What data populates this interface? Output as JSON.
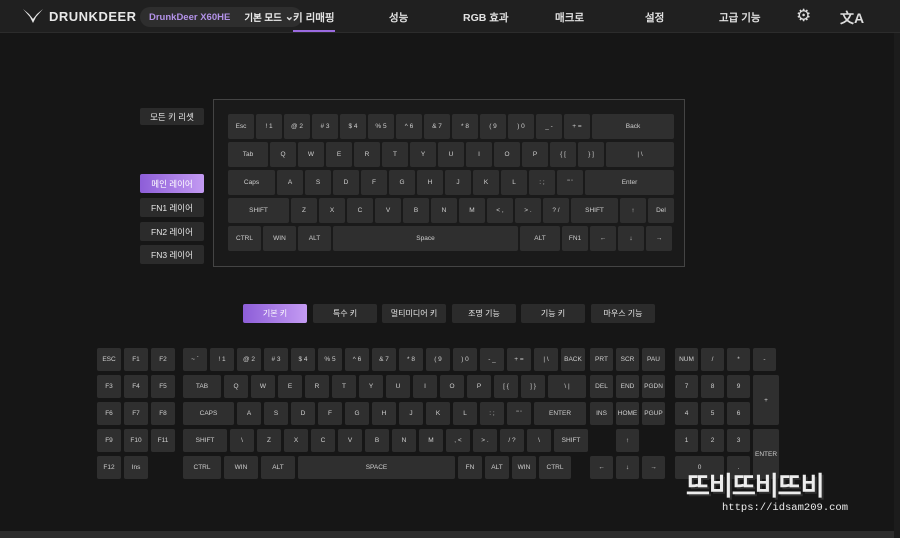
{
  "header": {
    "brand": "DRUNKDEER",
    "device": "DrunkDeer X60HE",
    "mode": "기본 모드",
    "nav": [
      "키 리매핑",
      "성능",
      "RGB 효과",
      "매크로",
      "설정",
      "고급 기능"
    ],
    "settings_icon": "gear-icon",
    "language_icon": "translate-icon"
  },
  "left_panel": {
    "reset_label": "모든 키 리셋",
    "layers": [
      "메인 레이어",
      "FN1 레이어",
      "FN2 레이어",
      "FN3 레이어"
    ],
    "active_layer": "메인 레이어"
  },
  "preview_keyboard": {
    "rows": [
      [
        "Esc",
        "! 1",
        "@ 2",
        "# 3",
        "$ 4",
        "% 5",
        "^ 6",
        "& 7",
        "* 8",
        "( 9",
        ") 0",
        "_ -",
        "+ =",
        "Back"
      ],
      [
        "Tab",
        "Q",
        "W",
        "E",
        "R",
        "T",
        "Y",
        "U",
        "I",
        "O",
        "P",
        "{ [",
        "} ]",
        "| \\"
      ],
      [
        "Caps",
        "A",
        "S",
        "D",
        "F",
        "G",
        "H",
        "J",
        "K",
        "L",
        ": ;",
        "\" '",
        "Enter"
      ],
      [
        "SHIFT",
        "Z",
        "X",
        "C",
        "V",
        "B",
        "N",
        "M",
        "< ,",
        "> .",
        "? /",
        "SHIFT",
        "↑",
        "Del"
      ],
      [
        "CTRL",
        "WIN",
        "ALT",
        "Space",
        "ALT",
        "FN1",
        "←",
        "↓",
        "→"
      ]
    ]
  },
  "category_tabs": {
    "items": [
      "기본 키",
      "특수 키",
      "멀티미디어 키",
      "조명 기능",
      "기능 키",
      "마우스 기능"
    ],
    "active": "기본 키"
  },
  "key_palette": {
    "fkeys": [
      [
        "ESC",
        "F1",
        "F2"
      ],
      [
        "F3",
        "F4",
        "F5"
      ],
      [
        "F6",
        "F7",
        "F8"
      ],
      [
        "F9",
        "F10",
        "F11"
      ],
      [
        "F12",
        "Ins"
      ]
    ],
    "main": [
      [
        "~ `",
        "! 1",
        "@ 2",
        "# 3",
        "$ 4",
        "% 5",
        "^ 6",
        "& 7",
        "* 8",
        "( 9",
        ") 0",
        "- _",
        "+ =",
        "| \\",
        "BACK"
      ],
      [
        "TAB",
        "Q",
        "W",
        "E",
        "R",
        "T",
        "Y",
        "U",
        "I",
        "O",
        "P",
        "[ {",
        "] }",
        "\\ |"
      ],
      [
        "CAPS",
        "A",
        "S",
        "D",
        "F",
        "G",
        "H",
        "J",
        "K",
        "L",
        ": ;",
        "\" '",
        "ENTER"
      ],
      [
        "SHIFT",
        "\\",
        "Z",
        "X",
        "C",
        "V",
        "B",
        "N",
        "M",
        ", <",
        "> .",
        "/ ?",
        "\\",
        "SHIFT"
      ],
      [
        "CTRL",
        "WIN",
        "ALT",
        "SPACE",
        "FN",
        "ALT",
        "WIN",
        "CTRL"
      ]
    ],
    "nav": [
      [
        "PRT",
        "SCR",
        "PAU"
      ],
      [
        "DEL",
        "END",
        "PGDN"
      ],
      [
        "INS",
        "HOME",
        "PGUP"
      ],
      [
        "↑"
      ],
      [
        "←",
        "↓",
        "→"
      ]
    ],
    "numpad": [
      [
        "NUM",
        "/",
        "*",
        "-"
      ],
      [
        "7",
        "8",
        "9",
        "+"
      ],
      [
        "4",
        "5",
        "6"
      ],
      [
        "1",
        "2",
        "3",
        "ENTER"
      ],
      [
        "0",
        "."
      ]
    ]
  },
  "watermark": {
    "text": "뜨비뜨비뜨비",
    "url": "https://idsam209.com"
  }
}
